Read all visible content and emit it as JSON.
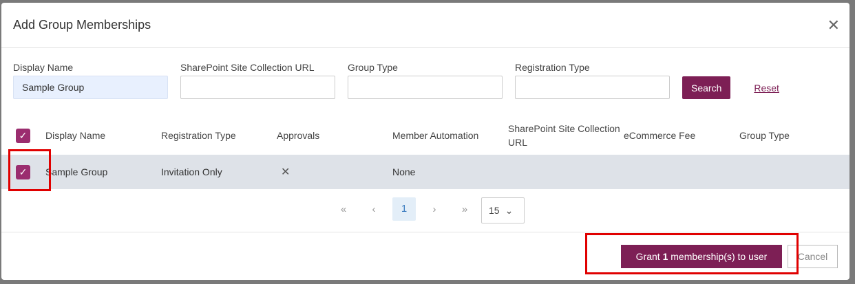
{
  "dialog": {
    "title": "Add Group Memberships",
    "close_icon": "close-icon"
  },
  "filters": {
    "display_name": {
      "label": "Display Name",
      "value": "Sample Group"
    },
    "sharepoint_url": {
      "label": "SharePoint Site Collection URL",
      "value": ""
    },
    "group_type": {
      "label": "Group Type",
      "value": ""
    },
    "registration_type": {
      "label": "Registration Type",
      "value": ""
    },
    "search_label": "Search",
    "reset_label": "Reset"
  },
  "table": {
    "headers": [
      "Display Name",
      "Registration Type",
      "Approvals",
      "Member Automation",
      "SharePoint Site Collection URL",
      "eCommerce Fee",
      "Group Type"
    ],
    "rows": [
      {
        "display_name": "Sample Group",
        "registration_type": "Invitation Only",
        "approvals": "✕",
        "member_automation": "None",
        "sharepoint_url": "",
        "ecommerce_fee": "",
        "group_type": "",
        "checked": true
      }
    ]
  },
  "pagination": {
    "first": "«",
    "prev": "‹",
    "current": "1",
    "next": "›",
    "last": "»",
    "page_size": "15"
  },
  "footer": {
    "grant_prefix": "Grant ",
    "grant_count": "1",
    "grant_suffix": " membership(s) to user",
    "cancel_label": "Cancel"
  },
  "colors": {
    "accent": "#7d1f55",
    "checkbox": "#9b2d6f",
    "highlight": "#e00000"
  }
}
